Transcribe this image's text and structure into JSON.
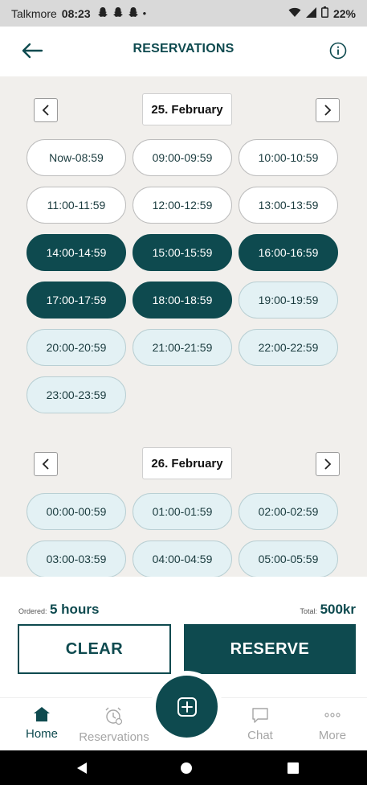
{
  "status_bar": {
    "carrier": "Talkmore",
    "time": "08:23",
    "battery": "22%"
  },
  "header": {
    "title": "RESERVATIONS"
  },
  "days": [
    {
      "date": "25. February",
      "slots": [
        {
          "label": "Now-08:59",
          "state": "available"
        },
        {
          "label": "09:00-09:59",
          "state": "available"
        },
        {
          "label": "10:00-10:59",
          "state": "available"
        },
        {
          "label": "11:00-11:59",
          "state": "available"
        },
        {
          "label": "12:00-12:59",
          "state": "available"
        },
        {
          "label": "13:00-13:59",
          "state": "available"
        },
        {
          "label": "14:00-14:59",
          "state": "selected"
        },
        {
          "label": "15:00-15:59",
          "state": "selected"
        },
        {
          "label": "16:00-16:59",
          "state": "selected"
        },
        {
          "label": "17:00-17:59",
          "state": "selected"
        },
        {
          "label": "18:00-18:59",
          "state": "selected"
        },
        {
          "label": "19:00-19:59",
          "state": "light"
        },
        {
          "label": "20:00-20:59",
          "state": "light"
        },
        {
          "label": "21:00-21:59",
          "state": "light"
        },
        {
          "label": "22:00-22:59",
          "state": "light"
        },
        {
          "label": "23:00-23:59",
          "state": "light"
        }
      ]
    },
    {
      "date": "26. February",
      "slots": [
        {
          "label": "00:00-00:59",
          "state": "light"
        },
        {
          "label": "01:00-01:59",
          "state": "light"
        },
        {
          "label": "02:00-02:59",
          "state": "light"
        },
        {
          "label": "03:00-03:59",
          "state": "light"
        },
        {
          "label": "04:00-04:59",
          "state": "light"
        },
        {
          "label": "05:00-05:59",
          "state": "light"
        }
      ]
    }
  ],
  "summary": {
    "ordered_label": "Ordered:",
    "ordered_value": "5 hours",
    "total_label": "Total:",
    "total_value": "500kr"
  },
  "actions": {
    "clear_label": "CLEAR",
    "reserve_label": "RESERVE"
  },
  "bottom_nav": {
    "items": [
      {
        "label": "Home",
        "icon": "home-icon",
        "active": true
      },
      {
        "label": "Reservations",
        "icon": "alarm-clock-icon",
        "active": false
      },
      {
        "label": "Chat",
        "icon": "chat-icon",
        "active": false
      },
      {
        "label": "More",
        "icon": "more-dots-icon",
        "active": false
      }
    ],
    "fab_icon": "plus-square-icon"
  },
  "colors": {
    "primary": "#0e4a4f",
    "background": "#f1efec",
    "slot_light": "#e3f1f4"
  }
}
